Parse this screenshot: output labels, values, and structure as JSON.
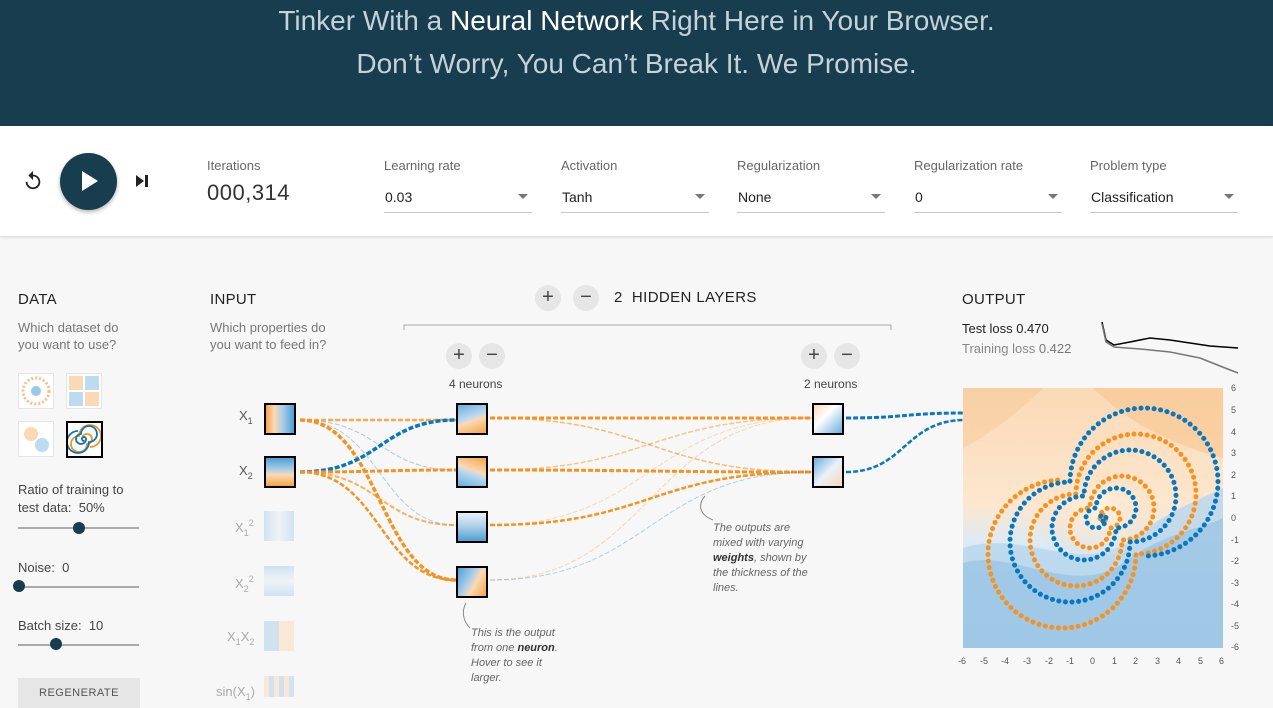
{
  "header": {
    "line1_pre": "Tinker With a ",
    "line1_bold": "Neural Network",
    "line1_post": " Right Here in Your Browser.",
    "line2": "Don’t Worry, You Can’t Break It. We Promise."
  },
  "controls": {
    "iterations_label": "Iterations",
    "iterations_value": "000,314",
    "learning_rate_label": "Learning rate",
    "learning_rate_value": "0.03",
    "activation_label": "Activation",
    "activation_value": "Tanh",
    "regularization_label": "Regularization",
    "regularization_value": "None",
    "regularization_rate_label": "Regularization rate",
    "regularization_rate_value": "0",
    "problem_type_label": "Problem type",
    "problem_type_value": "Classification",
    "icons": [
      "reset-icon",
      "play-icon",
      "step-icon"
    ]
  },
  "data_panel": {
    "title": "DATA",
    "subtitle": "Which dataset do you want to use?",
    "selected_dataset": "spiral",
    "ratio_label": "Ratio of training to test data:",
    "ratio_value": "50%",
    "ratio_fraction": 0.5,
    "noise_label": "Noise:",
    "noise_value": "0",
    "noise_fraction": 0,
    "batch_label": "Batch size:",
    "batch_value": "10",
    "batch_fraction": 0.31,
    "regenerate_label": "REGENERATE"
  },
  "input_panel": {
    "title": "INPUT",
    "subtitle": "Which properties do you want to feed in?",
    "features": [
      {
        "base": "X",
        "sub": "1",
        "sup": "",
        "active": true
      },
      {
        "base": "X",
        "sub": "2",
        "sup": "",
        "active": true
      },
      {
        "base": "X",
        "sub": "1",
        "sup": "2",
        "active": false
      },
      {
        "base": "X",
        "sub": "2",
        "sup": "2",
        "active": false
      },
      {
        "base": "X",
        "sub": "1",
        "sup": "",
        "base2": "X",
        "sub2": "2",
        "active": false
      },
      {
        "base": "sin(X",
        "sub": "1",
        "post": ")",
        "active": false
      }
    ]
  },
  "network": {
    "hidden_layers_count": "2",
    "hidden_layers_label": "HIDDEN LAYERS",
    "layer1_neurons": "4 neurons",
    "layer2_neurons": "2 neurons",
    "note_neuron_1": "This is the output from one ",
    "note_neuron_bold": "neuron",
    "note_neuron_2": ". Hover to see it larger.",
    "note_weights_1": "The outputs are mixed with varying ",
    "note_weights_bold": "weights",
    "note_weights_2": ", shown by the thickness of the lines.",
    "colors": {
      "positive": "#0877bd",
      "negative": "#f59322"
    }
  },
  "output_panel": {
    "title": "OUTPUT",
    "test_loss_label": "Test loss",
    "test_loss_value": "0.470",
    "training_loss_label": "Training loss",
    "training_loss_value": "0.422",
    "y_ticks": [
      "6",
      "5",
      "4",
      "3",
      "2",
      "1",
      "0",
      "-1",
      "-2",
      "-3",
      "-4",
      "-5",
      "-6"
    ],
    "x_ticks": [
      "-6",
      "-5",
      "-4",
      "-3",
      "-2",
      "-1",
      "0",
      "1",
      "2",
      "3",
      "4",
      "5",
      "6"
    ]
  }
}
